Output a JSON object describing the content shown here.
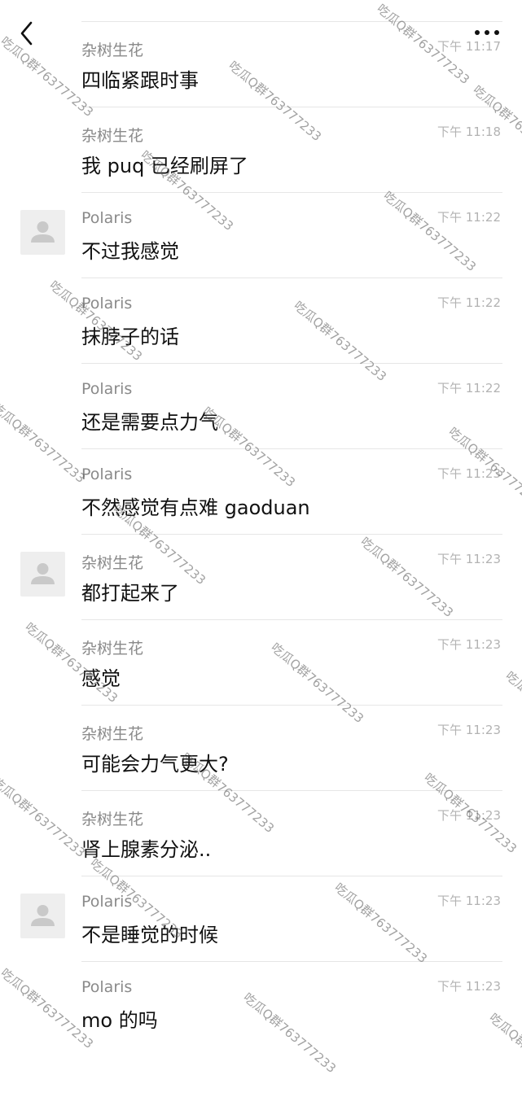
{
  "header": {
    "back_icon": "chevron-left-icon",
    "more_icon": "more-dots-icon"
  },
  "messages": [
    {
      "sender": "杂树生花",
      "time": "下午 11:17",
      "text": "四临紧跟时事",
      "avatar": false
    },
    {
      "sender": "杂树生花",
      "time": "下午 11:18",
      "text": "我 puq 已经刷屏了",
      "avatar": false
    },
    {
      "sender": "Polaris",
      "time": "下午 11:22",
      "text": "不过我感觉",
      "avatar": true
    },
    {
      "sender": "Polaris",
      "time": "下午 11:22",
      "text": "抹脖子的话",
      "avatar": false
    },
    {
      "sender": "Polaris",
      "time": "下午 11:22",
      "text": "还是需要点力气",
      "avatar": false
    },
    {
      "sender": "Polaris",
      "time": "下午 11:23",
      "text": "不然感觉有点难 gaoduan",
      "avatar": false
    },
    {
      "sender": "杂树生花",
      "time": "下午 11:23",
      "text": "都打起来了",
      "avatar": true
    },
    {
      "sender": "杂树生花",
      "time": "下午 11:23",
      "text": "感觉",
      "avatar": false
    },
    {
      "sender": "杂树生花",
      "time": "下午 11:23",
      "text": "可能会力气更大?",
      "avatar": false
    },
    {
      "sender": "杂树生花",
      "time": "下午 11:23",
      "text": "肾上腺素分泌..",
      "avatar": false
    },
    {
      "sender": "Polaris",
      "time": "下午 11:23",
      "text": "不是睡觉的时候",
      "avatar": true
    },
    {
      "sender": "Polaris",
      "time": "下午 11:23",
      "text": "mo 的吗",
      "avatar": false
    }
  ],
  "watermark": {
    "text": "吃瓜Q群763777233"
  }
}
